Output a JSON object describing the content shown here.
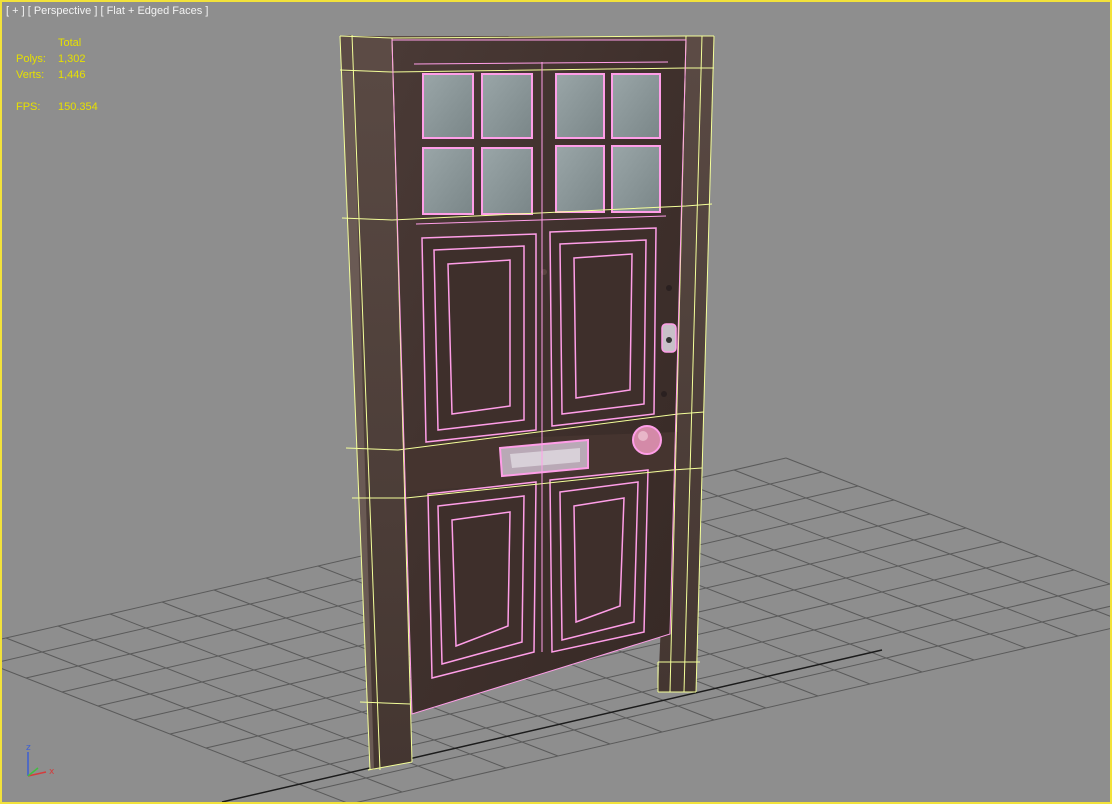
{
  "viewport": {
    "label": "[ + ] [ Perspective ] [ Flat + Edged Faces ]",
    "border_color": "#f2e23a",
    "background": "#8e8e8e"
  },
  "stats": {
    "header": "Total",
    "polys_label": "Polys:",
    "polys_value": "1,302",
    "verts_label": "Verts:",
    "verts_value": "1,446",
    "fps_label": "FPS:",
    "fps_value": "150.354",
    "color": "#e6e000"
  },
  "axis_gizmo": {
    "z_label": "z",
    "x_label": "x",
    "z_color": "#3c5fd4",
    "x_color": "#d43c3c"
  },
  "scene": {
    "object": "door-model",
    "frame_wire_color": "#f4ff9a",
    "door_wire_color": "#ff9ee8",
    "grid_color": "#5a5a5a"
  }
}
